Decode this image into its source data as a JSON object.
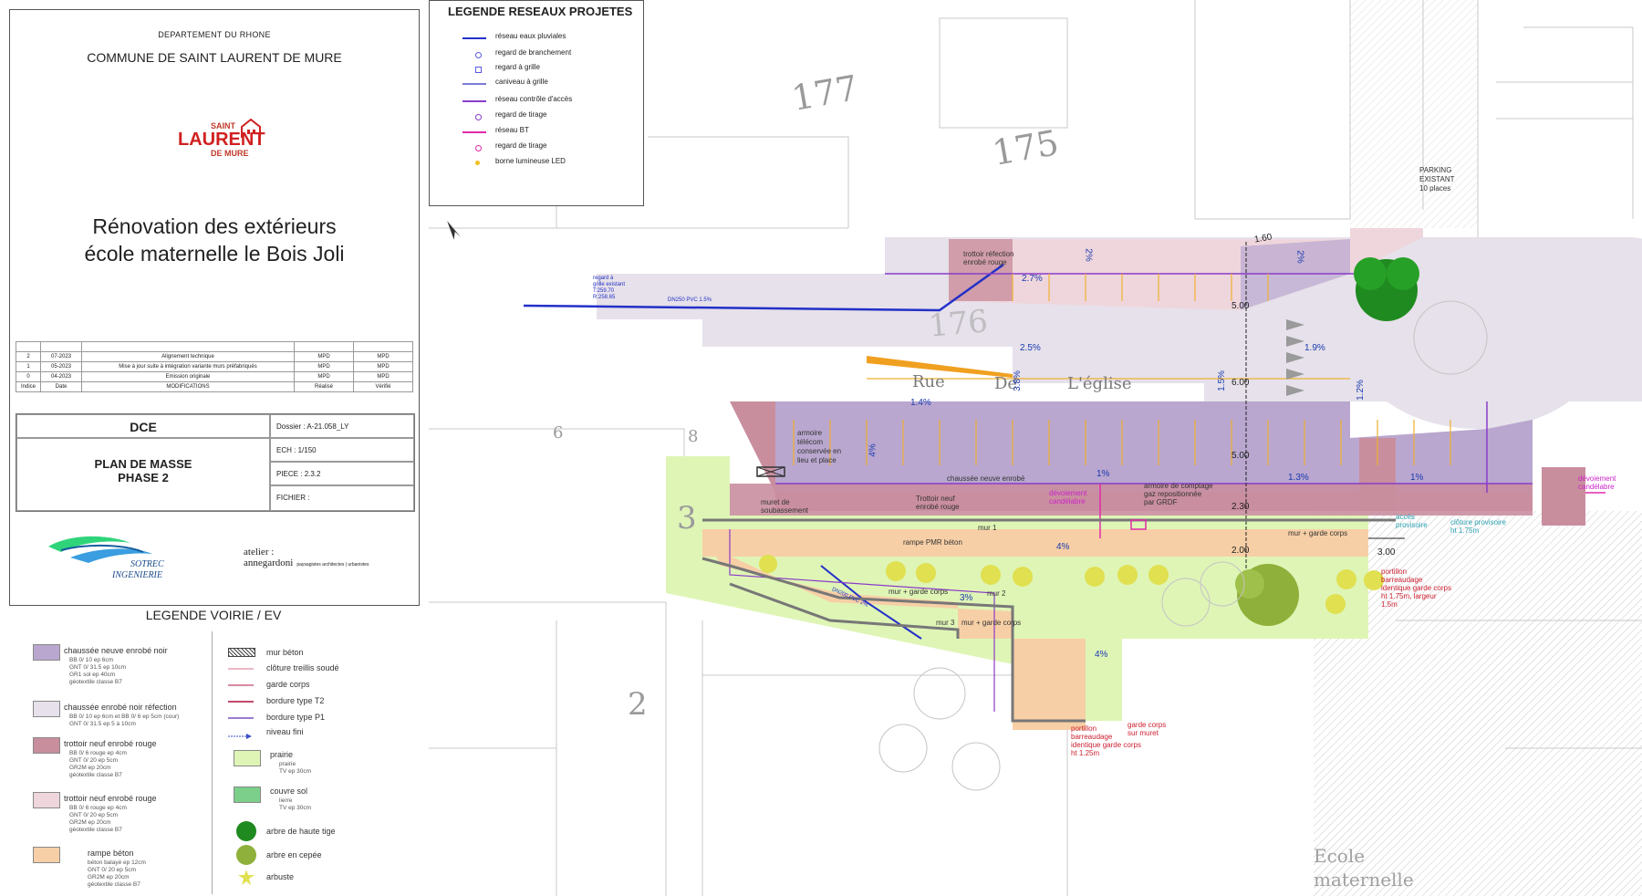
{
  "title_block": {
    "department": "DEPARTEMENT DU RHONE",
    "commune": "COMMUNE DE SAINT LAURENT DE MURE",
    "logo": {
      "line1": "SAINT",
      "line2": "LAURENT",
      "line3": "DE MURE"
    },
    "project_title_1": "Rénovation des extérieurs",
    "project_title_2": "école maternelle le Bois Joli",
    "revisions": [
      {
        "indice": "2",
        "date": "07-2023",
        "modif": "Alignement technique",
        "realise": "MPD",
        "verifie": "MPD"
      },
      {
        "indice": "1",
        "date": "05-2023",
        "modif": "Mise à jour suite à intégration variante murs préfabriqués",
        "realise": "MPD",
        "verifie": "MPD"
      },
      {
        "indice": "0",
        "date": "04-2023",
        "modif": "Emission originale",
        "realise": "MPD",
        "verifie": "MPD"
      }
    ],
    "rev_headers": {
      "indice": "Indice",
      "date": "Date",
      "modif": "MODIFICATIONS",
      "realise": "Réalisé",
      "verifie": "Vérifié"
    },
    "phase": "DCE",
    "plan_title_1": "PLAN DE MASSE",
    "plan_title_2": "PHASE 2",
    "dossier_label": "Dossier :",
    "dossier_value": "A-21.058_LY",
    "ech_label": "ECH :",
    "ech_value": "1/150",
    "piece_label": "PIECE :",
    "piece_value": "2.3.2",
    "fichier_label": "FICHIER :",
    "company1_line1": "SOTREC",
    "company1_line2": "INGENIERIE",
    "company2_line1": "atelier :",
    "company2_line2": "annegardoni",
    "company2_sub": "paysagistes architectes | urbanistes"
  },
  "legend_voirie": {
    "title": "LEGENDE VOIRIE / EV",
    "left": [
      {
        "label": "chaussée neuve enrobé noir",
        "color": "#b9a7cf",
        "sub": [
          "BB 0/ 10 ep 6cm",
          "GNT 0/ 31.5 ep 10cm",
          "GR1 sol ep 40cm",
          "géotextile classe B7"
        ]
      },
      {
        "label": "chaussée enrobé noir réfection",
        "color": "#e6e1ea",
        "sub": [
          "BB 0/ 10 ep 6cm et BB 0/ 6 ep 5cm (cour)",
          "GNT 0/ 31.5 ep 5 à 10cm"
        ]
      },
      {
        "label": "trottoir neuf enrobé rouge",
        "color": "#c98e9e",
        "sub": [
          "BB 0/ 6 rouge ep 4cm",
          "GNT 0/ 20 ep 5cm",
          "GR2M ep 20cm",
          "géotextile classe B7"
        ]
      },
      {
        "label": "trottoir neuf enrobé rouge",
        "color": "#efd6dc",
        "sub": [
          "BB 0/ 6 rouge ep 4cm",
          "GNT 0/ 20 ep 5cm",
          "GR2M ep 20cm",
          "géotextile classe B7"
        ]
      },
      {
        "label": "rampe béton",
        "color": "#f7cfa6",
        "sub": [
          "béton balayé ep 12cm",
          "GNT 0/ 20 ep 5cm",
          "GR2M ep 20cm",
          "géotextile classe B7"
        ]
      }
    ],
    "right": [
      {
        "label": "mur béton",
        "kind": "hatch"
      },
      {
        "label": "clôture treillis soudé",
        "kind": "line",
        "color": "#e9b9c4"
      },
      {
        "label": "garde corps",
        "kind": "line",
        "color": "#d98aa0"
      },
      {
        "label": "bordure type T2",
        "kind": "line",
        "color": "#c04a6a"
      },
      {
        "label": "bordure type P1",
        "kind": "line",
        "color": "#9c7ad0"
      },
      {
        "label": "niveau fini",
        "kind": "level",
        "color": "#3a4fc4"
      },
      {
        "label": "prairie",
        "kind": "box",
        "color": "#dff5b6",
        "sub": [
          "prairie",
          "TV ep 30cm"
        ]
      },
      {
        "label": "couvre sol",
        "kind": "box",
        "color": "#7bcf8b",
        "sub": [
          "lierre",
          "TV ep 30cm"
        ]
      },
      {
        "label": "arbre de haute tige",
        "kind": "tree",
        "color": "#1f8a1f"
      },
      {
        "label": "arbre en cepée",
        "kind": "tree",
        "color": "#8fb03a"
      },
      {
        "label": "arbuste",
        "kind": "shrub",
        "color": "#e0e050"
      }
    ]
  },
  "legend_reseaux": {
    "title": "LEGENDE RESEAUX PROJETES",
    "items": [
      {
        "label": "réseau eaux pluviales",
        "kind": "line",
        "color": "#2330c8"
      },
      {
        "label": "regard de branchement",
        "kind": "dot",
        "color": "#5a5ae0"
      },
      {
        "label": "regard à grille",
        "kind": "square",
        "color": "#5a5ae0"
      },
      {
        "label": "caniveau à grille",
        "kind": "line",
        "color": "#7b7bd8"
      },
      {
        "label": "réseau contrôle d'accès",
        "kind": "line",
        "color": "#8a3cc8"
      },
      {
        "label": "regard de tirage",
        "kind": "dot",
        "color": "#8a3cc8"
      },
      {
        "label": "réseau BT",
        "kind": "line",
        "color": "#e02aa8"
      },
      {
        "label": "regard de tirage",
        "kind": "dot",
        "color": "#e02aa8"
      },
      {
        "label": "borne lumineuse LED",
        "kind": "dot",
        "color": "#f0c020"
      }
    ]
  },
  "map": {
    "parcels": [
      "177",
      "175",
      "176",
      "3",
      "2",
      "6",
      "8"
    ],
    "street_words": [
      "Rue",
      "De",
      "L'église"
    ],
    "school": [
      "Ecole",
      "maternelle"
    ],
    "parking": [
      "PARKING",
      "EXISTANT",
      "10 places"
    ],
    "dims": [
      "1.60",
      "5.00",
      "6.00",
      "5.00",
      "2.30",
      "2.00",
      "3.00"
    ],
    "slopes": [
      "2%",
      "2.7%",
      "2%",
      "2.5%",
      "1.9%",
      "3.8%",
      "1.5%",
      "1.2%",
      "1.4%",
      "4%",
      "1%",
      "1.3%",
      "1%",
      "4%",
      "3%",
      "4%"
    ],
    "labels": {
      "trottoir_refection": [
        "trottoir réfection",
        "enrobé rouge"
      ],
      "armoire_telecom": [
        "armoire",
        "télécom",
        "conservée en",
        "lieu et place"
      ],
      "chaussee_neuve": "chaussée neuve enrobé",
      "trottoir_neuf": [
        "Trottoir neuf",
        "enrobé rouge"
      ],
      "deviation_candelabre": [
        "dévoiement",
        "candélabre"
      ],
      "armoire_comptage": [
        "armoire de comptage",
        "gaz repositionnée",
        "par GRDF"
      ],
      "muret": [
        "muret de",
        "soubassement"
      ],
      "mur1": "mur 1",
      "mur_garde_corps": "mur + garde corps",
      "rampe_pmr": "rampe PMR béton",
      "mur2": "mur 2",
      "mur3": "mur 3",
      "acces_provisoire": [
        "accès",
        "provisoire"
      ],
      "cloture_provisoire": [
        "clôture provisoire",
        "ht 1.75m"
      ],
      "deviation_right": [
        "dévoiement",
        "candélabre"
      ],
      "portillon_right": [
        "portillon",
        "barreaudage",
        "identique garde corps",
        "ht 1.75m, largeur",
        "1.5m"
      ],
      "portillon_bottom": [
        "portillon",
        "barreaudage",
        "identique garde corps",
        "ht 1.25m"
      ],
      "garde_corps_muret": [
        "garde corps",
        "sur muret"
      ],
      "regard_existant": [
        "regard à",
        "grille existant",
        "T:259.70",
        "R:258.65"
      ],
      "dn250": "DN250 PVC 1.5%",
      "dn200": "DN200 PVC 2%"
    }
  }
}
